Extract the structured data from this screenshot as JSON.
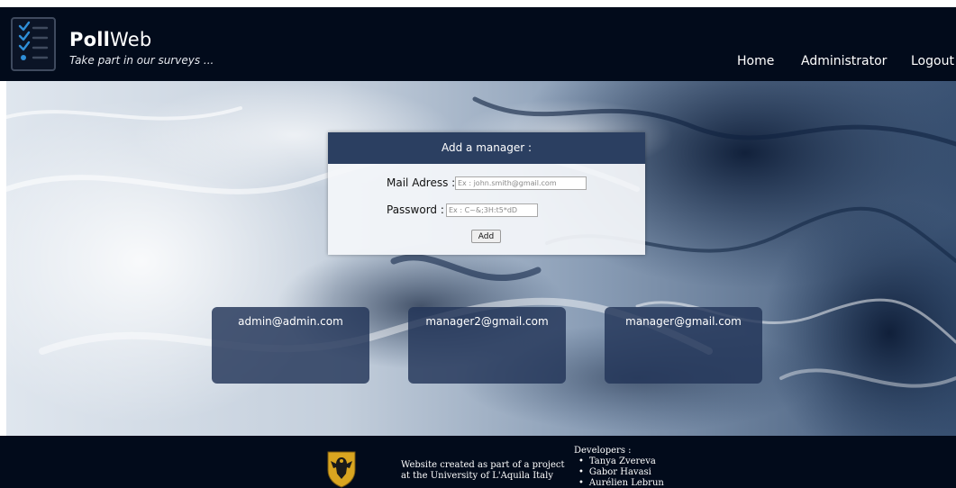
{
  "header": {
    "brand_bold": "Poll",
    "brand_light": "Web",
    "tagline": "Take part in our surveys ...",
    "logo_icon": "checklist-icon",
    "nav": {
      "home": "Home",
      "administrator": "Administrator",
      "logout": "Logout"
    }
  },
  "form": {
    "title": "Add a manager :",
    "mail_label": "Mail Adress :",
    "mail_placeholder": "Ex : john.smith@gmail.com",
    "mail_value": "",
    "password_label": "Password :",
    "password_placeholder": "Ex : C~&;3H:t5*dD",
    "password_value": "",
    "add_label": "Add"
  },
  "managers": [
    {
      "email": "admin@admin.com"
    },
    {
      "email": "manager2@gmail.com"
    },
    {
      "email": "manager@gmail.com"
    }
  ],
  "footer": {
    "crest_icon": "university-crest-icon",
    "project_line1": "Website created as part of a project",
    "project_line2": "at the University of L'Aquila Italy",
    "developers_title": "Developers :",
    "developers": [
      "Tanya Zvereva",
      "Gabor Havasi",
      "Aurélien Lebrun"
    ]
  },
  "colors": {
    "header_bg": "#020b1b",
    "form_header_bg": "#2b3f61",
    "card_bg": "#223458",
    "accent_blue": "#2f8fd8"
  }
}
